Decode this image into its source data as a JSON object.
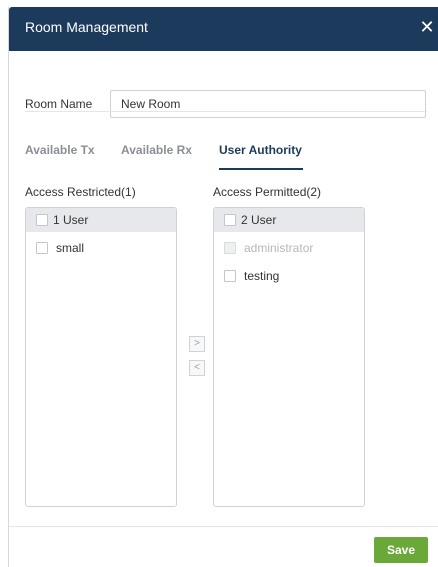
{
  "dialog": {
    "title": "Room Management",
    "close_icon": "close-icon"
  },
  "room_name": {
    "label": "Room Name",
    "value": "New Room"
  },
  "tabs": [
    {
      "label": "Available Tx",
      "active": false
    },
    {
      "label": "Available Rx",
      "active": false
    },
    {
      "label": "User Authority",
      "active": true
    }
  ],
  "restricted": {
    "title": "Access Restricted(1)",
    "header_label": "1 User",
    "items": [
      {
        "label": "small",
        "disabled": false
      }
    ]
  },
  "permitted": {
    "title": "Access Permitted(2)",
    "header_label": "2 User",
    "items": [
      {
        "label": "administrator",
        "disabled": true
      },
      {
        "label": "testing",
        "disabled": false
      }
    ]
  },
  "transfer": {
    "move_right": ">",
    "move_left": "<"
  },
  "footer": {
    "save_label": "Save"
  },
  "colors": {
    "header_bg": "#1b3a5c",
    "save_bg": "#6aa83a"
  }
}
